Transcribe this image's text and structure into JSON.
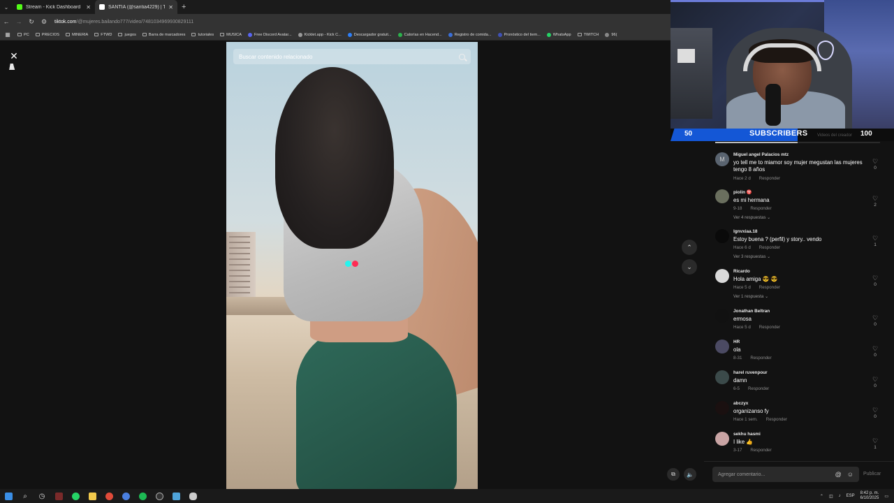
{
  "browser": {
    "tabs": [
      {
        "title": "Stream - Kick Dashboard",
        "favicon_color": "#53fc18",
        "active": false
      },
      {
        "title": "SANTIA (@santia4229) | TikTok",
        "favicon_color": "#ffffff",
        "active": true
      }
    ],
    "url_host": "tiktok.com",
    "url_path": "/@mujeres.bailando777/video/7481034969930829111",
    "bookmarks": [
      "PC",
      "PRECIOS",
      "MINERIA",
      "FTWD",
      "juegos",
      "Barra de marcadores",
      "tutoriales",
      "MUSICA",
      "Free Discord Avatar...",
      "Kicklet.app - Kick C...",
      "Descargador gratuit...",
      "Calorías en Hacend...",
      "Registro de comida...",
      "Pronóstico del tiem...",
      "WhatsApp",
      "TWITCH",
      "96("
    ]
  },
  "video": {
    "search_placeholder": "Buscar contenido relacionado",
    "loader_colors": [
      "#25f4ee",
      "#fe2c55"
    ]
  },
  "stream_overlay": {
    "sub_goal_low": "50",
    "sub_goal_label": "SUBSCRIBERS",
    "sub_goal_high": "100",
    "hidden_tab_text": "Videos del creador",
    "progress_fraction": 0.57,
    "bar_color": "#1457d6"
  },
  "comments": [
    {
      "user": "Miguel angel Palacios mtz",
      "avatar": "M",
      "text": "yo tell me to miamor soy mujer megustan las mujeres tengo 8 años",
      "time": "Hace 2 d",
      "reply": "Responder",
      "likes": "0",
      "replies": ""
    },
    {
      "user": "piolin ♈",
      "avatar": "",
      "text": "es mi hermana",
      "time": "9-18",
      "reply": "Responder",
      "likes": "2",
      "replies": "Ver 4 respuestas"
    },
    {
      "user": "lgnvxiaa.18",
      "avatar": "",
      "text": "Estoy buena ? (perfil) y story.. vendo",
      "time": "Hace 6 d",
      "reply": "Responder",
      "likes": "1",
      "replies": "Ver 3 respuestas"
    },
    {
      "user": "Ricardo",
      "avatar": "",
      "text": "Hola amiga 😎 😎",
      "time": "Hace 5 d",
      "reply": "Responder",
      "likes": "0",
      "replies": "Ver 1 respuesta"
    },
    {
      "user": "Jonathan Beltran",
      "avatar": "",
      "text": "ermosa",
      "time": "Hace 5 d",
      "reply": "Responder",
      "likes": "0",
      "replies": ""
    },
    {
      "user": "HR",
      "avatar": "",
      "text": "ola",
      "time": "8-31",
      "reply": "Responder",
      "likes": "0",
      "replies": ""
    },
    {
      "user": "harel ruvenpour",
      "avatar": "",
      "text": "damn",
      "time": "6-5",
      "reply": "Responder",
      "likes": "0",
      "replies": ""
    },
    {
      "user": "abczyx",
      "avatar": "",
      "text": "organizanso fy",
      "time": "Hace 1 sem.",
      "reply": "Responder",
      "likes": "0",
      "replies": ""
    },
    {
      "user": "sekhu hasmi",
      "avatar": "",
      "text": "I like 👍",
      "time": "3-17",
      "reply": "Responder",
      "likes": "1",
      "replies": ""
    }
  ],
  "comment_box": {
    "placeholder": "Agregar comentario...",
    "post_label": "Publicar"
  },
  "taskbar": {
    "time": "8:42 p. m.",
    "date": "6/10/2025",
    "lang": "ESP"
  }
}
